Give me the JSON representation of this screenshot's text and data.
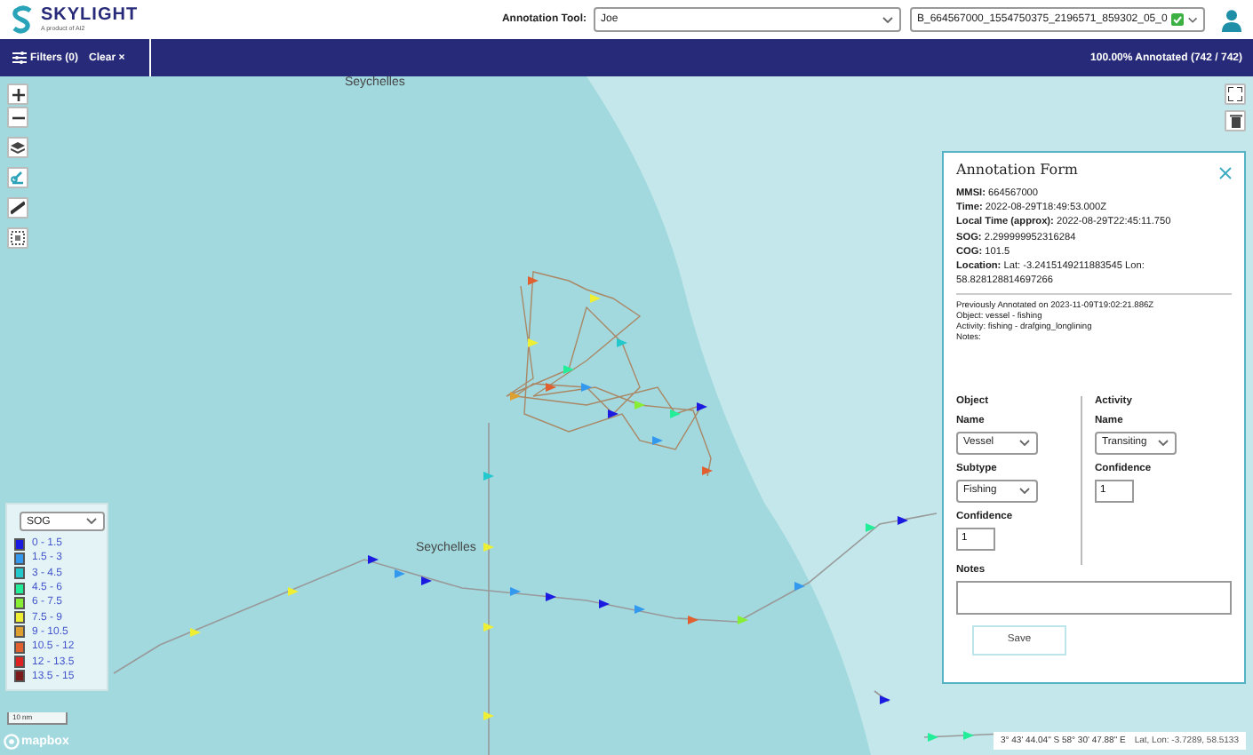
{
  "header": {
    "logo_title": "SKYLIGHT",
    "logo_subtitle": "A product of AI2",
    "annotation_tool_label": "Annotation Tool:",
    "annotator": "Joe",
    "track_id": "B_664567000_1554750375_2196571_859302_05_0",
    "track_done": true
  },
  "toolbar": {
    "filters": "Filters (0)",
    "clear": "Clear ×",
    "progress": "100.00% Annotated (742 / 742)"
  },
  "map": {
    "labels": [
      "Seychelles",
      "Seychelles"
    ],
    "scale": "10 nm",
    "attribution": "mapbox",
    "coordinates": "3° 43' 44.04\" S 58° 30' 47.88\" E",
    "latlon": "Lat, Lon: -3.7289, 58.5133"
  },
  "legend": {
    "dropdown": "SOG",
    "items": [
      {
        "label": "0 - 1.5",
        "color": "#1a1ae0"
      },
      {
        "label": "1.5 - 3",
        "color": "#3399ee"
      },
      {
        "label": "3 - 4.5",
        "color": "#22c8cc"
      },
      {
        "label": "4.5 - 6",
        "color": "#22ee99"
      },
      {
        "label": "6 - 7.5",
        "color": "#88ee33"
      },
      {
        "label": "7.5 - 9",
        "color": "#eeee33"
      },
      {
        "label": "9 - 10.5",
        "color": "#dda030"
      },
      {
        "label": "10.5 - 12",
        "color": "#e06030"
      },
      {
        "label": "12 - 13.5",
        "color": "#dd2222"
      },
      {
        "label": "13.5 - 15",
        "color": "#7a1a1a"
      }
    ]
  },
  "form": {
    "title": "Annotation Form",
    "details": [
      "**MMSI:** 664567000",
      "**Time:** 2022-08-29T18:49:53.000Z",
      "**Local Time (approx):** 2022-08-29T22:45:11.750",
      "**SOG:** 2.299999952316284",
      "**COG:** 101.5",
      "**Location:** Lat: -3.2415149211883545 Lon: 58.828128814697266"
    ],
    "previous": [
      "Previously Annotated on 2023-11-09T19:02:21.886Z",
      "Object: vessel - fishing",
      "Activity: fishing - drafging_longlining",
      "Notes:"
    ],
    "columns": [
      {
        "heading": "Object",
        "fields": [
          {
            "kind": "select",
            "label": "Name",
            "value": "Vessel"
          },
          {
            "kind": "select",
            "label": "Subtype",
            "value": "Fishing"
          },
          {
            "kind": "input",
            "label": "Confidence",
            "value": "1"
          }
        ]
      },
      {
        "heading": "Activity",
        "fields": [
          {
            "kind": "select",
            "label": "Name",
            "value": "Transiting"
          },
          {
            "kind": "input",
            "label": "Confidence",
            "value": "1"
          }
        ]
      }
    ],
    "notes_label": "Notes",
    "save": "Save"
  }
}
